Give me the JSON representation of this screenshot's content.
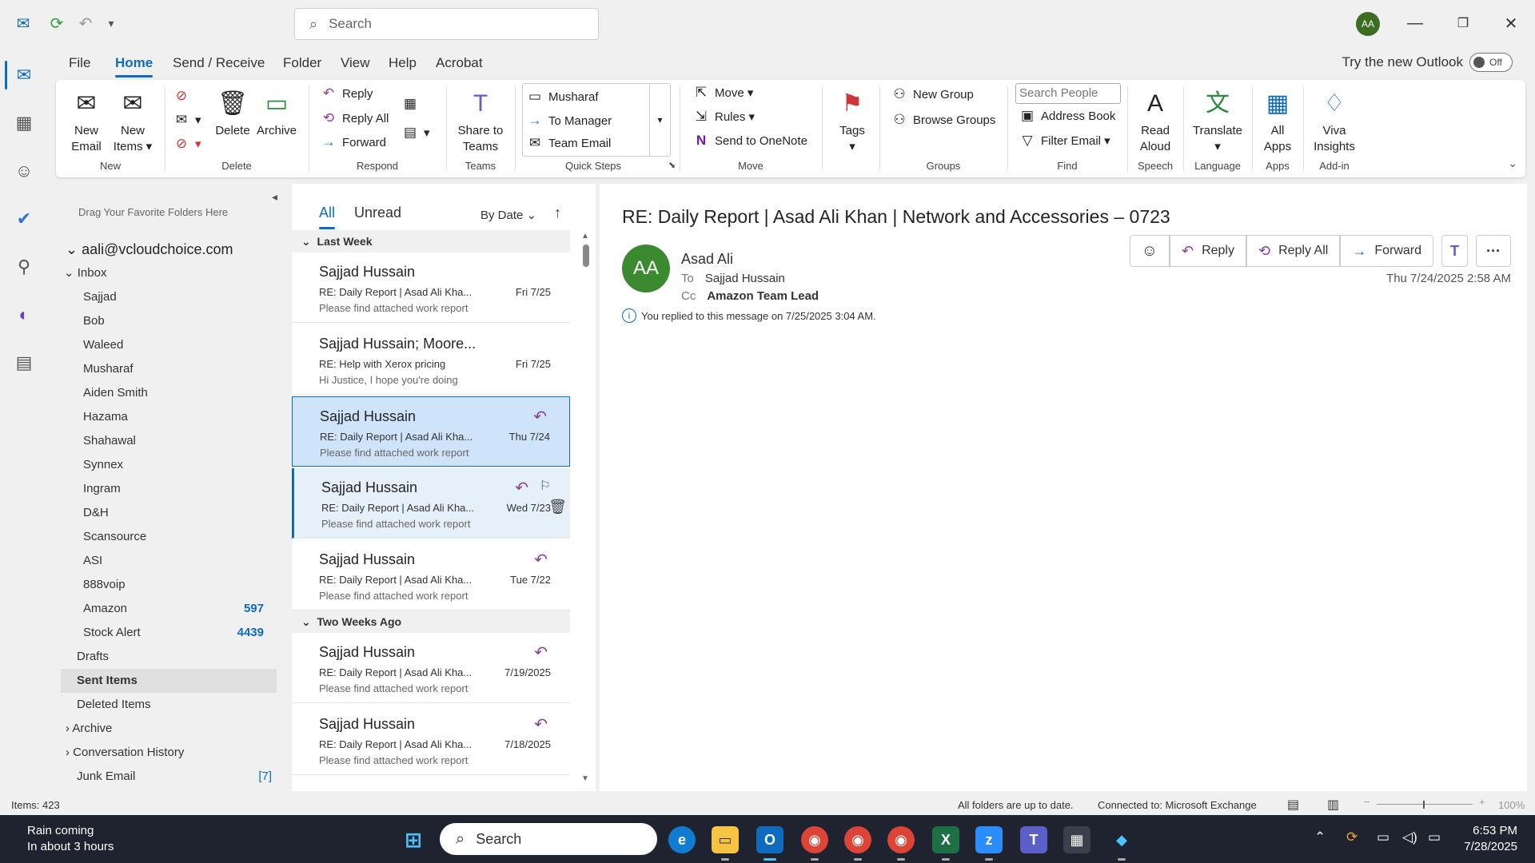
{
  "titlebar": {
    "search_placeholder": "Search",
    "avatar_initials": "AA"
  },
  "menu": {
    "tabs": [
      "File",
      "Home",
      "Send / Receive",
      "Folder",
      "View",
      "Help",
      "Acrobat"
    ],
    "active_tab": "Home",
    "try_new": "Try the new Outlook",
    "toggle_label": "Off"
  },
  "ribbon": {
    "new_email": [
      "New",
      "Email"
    ],
    "new_items": [
      "New",
      "Items"
    ],
    "delete": "Delete",
    "archive": "Archive",
    "reply": "Reply",
    "reply_all": "Reply All",
    "forward": "Forward",
    "share_teams": [
      "Share to",
      "Teams"
    ],
    "qs_musharaf": "Musharaf",
    "qs_manager": "To Manager",
    "qs_team_email": "Team Email",
    "move": "Move",
    "rules": "Rules",
    "onenote": "Send to OneNote",
    "tags": "Tags",
    "new_group": "New Group",
    "browse_groups": "Browse Groups",
    "search_people": "Search People",
    "address_book": "Address Book",
    "filter_email": "Filter Email",
    "read_aloud": [
      "Read",
      "Aloud"
    ],
    "translate": "Translate",
    "all_apps": [
      "All",
      "Apps"
    ],
    "viva": [
      "Viva",
      "Insights"
    ],
    "groups": {
      "new": "New",
      "delete": "Delete",
      "respond": "Respond",
      "teams": "Teams",
      "quick_steps": "Quick Steps",
      "move": "Move",
      "groups": "Groups",
      "find": "Find",
      "speech": "Speech",
      "language": "Language",
      "apps": "Apps",
      "addin": "Add-in"
    }
  },
  "folders": {
    "hint": "Drag Your Favorite Folders Here",
    "account": "aali@vcloudchoice.com",
    "inbox": "Inbox",
    "subfolders": [
      {
        "name": "Sajjad",
        "count": ""
      },
      {
        "name": "Bob",
        "count": ""
      },
      {
        "name": "Waleed",
        "count": ""
      },
      {
        "name": "Musharaf",
        "count": ""
      },
      {
        "name": "Aiden Smith",
        "count": ""
      },
      {
        "name": "Hazama",
        "count": ""
      },
      {
        "name": "Shahawal",
        "count": ""
      },
      {
        "name": "Synnex",
        "count": ""
      },
      {
        "name": "Ingram",
        "count": ""
      },
      {
        "name": "D&H",
        "count": ""
      },
      {
        "name": "Scansource",
        "count": ""
      },
      {
        "name": "ASI",
        "count": ""
      },
      {
        "name": "888voip",
        "count": ""
      },
      {
        "name": "Amazon",
        "count": "597"
      },
      {
        "name": "Stock Alert",
        "count": "4439"
      }
    ],
    "drafts": "Drafts",
    "sent": "Sent Items",
    "deleted": "Deleted Items",
    "archive": "Archive",
    "conversation": "Conversation History",
    "junk": "Junk Email",
    "junk_count": "[7]"
  },
  "list": {
    "tab_all": "All",
    "tab_unread": "Unread",
    "sort": "By Date",
    "group_last_week": "Last Week",
    "group_two_weeks": "Two Weeks Ago",
    "messages": [
      {
        "sender": "Sajjad Hussain",
        "subject": "RE: Daily Report | Asad Ali Kha...",
        "preview": "Please find attached work report",
        "date": "Fri 7/25"
      },
      {
        "sender": "Sajjad Hussain; Moore...",
        "subject": "RE: Help with Xerox pricing",
        "preview": "Hi Justice,  I hope you're doing",
        "date": "Fri 7/25"
      },
      {
        "sender": "Sajjad Hussain",
        "subject": "RE: Daily Report | Asad Ali Kha...",
        "preview": "Please find attached work report",
        "date": "Thu 7/24"
      },
      {
        "sender": "Sajjad Hussain",
        "subject": "RE: Daily Report | Asad Ali Kha...",
        "preview": "Please find attached work report",
        "date": "Wed 7/23"
      },
      {
        "sender": "Sajjad Hussain",
        "subject": "RE: Daily Report | Asad Ali Kha...",
        "preview": "Please find attached work report",
        "date": "Tue 7/22"
      },
      {
        "sender": "Sajjad Hussain",
        "subject": "RE: Daily Report | Asad Ali Kha...",
        "preview": "Please find attached work report",
        "date": "7/19/2025"
      },
      {
        "sender": "Sajjad Hussain",
        "subject": "RE: Daily Report | Asad Ali Kha...",
        "preview": "Please find attached work report",
        "date": "7/18/2025"
      }
    ]
  },
  "reading": {
    "subject": "RE: Daily Report | Asad Ali Khan | Network and Accessories – 0723",
    "avatar": "AA",
    "from": "Asad Ali",
    "to_label": "To",
    "to": "Sajjad Hussain",
    "cc_label": "Cc",
    "cc": "Amazon Team Lead",
    "info": "You replied to this message on 7/25/2025 3:04 AM.",
    "reply": "Reply",
    "reply_all": "Reply All",
    "forward": "Forward",
    "date": "Thu 7/24/2025 2:58 AM"
  },
  "status": {
    "items": "Items: 423",
    "uptodate": "All folders are up to date.",
    "connected": "Connected to: Microsoft Exchange",
    "zoom": "100%"
  },
  "taskbar": {
    "weather_title": "Rain coming",
    "weather_sub": "In about 3 hours",
    "search": "Search",
    "time": "6:53 PM",
    "date": "7/28/2025"
  },
  "colors": {
    "accent": "#0f6cbd",
    "avatar_green": "#3b8a2f",
    "reply_icon": "#8a3d9c"
  }
}
